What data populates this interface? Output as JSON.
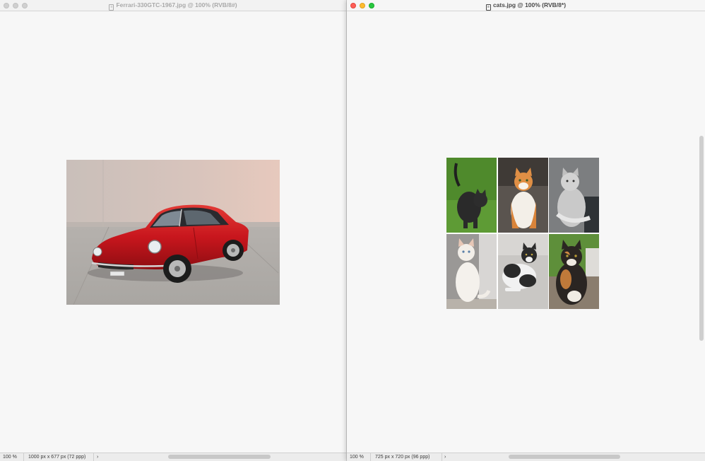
{
  "left_window": {
    "title": "Ferrari-330GTC-1967.jpg @ 100% (RVB/8#)",
    "zoom": "100 %",
    "doc_info": "1000 px x 677 px (72 ppp)",
    "arrow": "›",
    "state": "inactive"
  },
  "right_window": {
    "title": "cats.jpg @ 100% (RVB/8*)",
    "zoom": "100 %",
    "doc_info": "725 px x 720 px (96 ppp)",
    "arrow": "›",
    "state": "active"
  },
  "icons": {
    "traffic_lights": [
      "close-icon",
      "minimize-icon",
      "zoom-icon"
    ],
    "document": "document-icon"
  },
  "colors": {
    "close": "#ff5f57",
    "minimize": "#febc2e",
    "zoom": "#28c840",
    "car_red": "#c8161d"
  }
}
